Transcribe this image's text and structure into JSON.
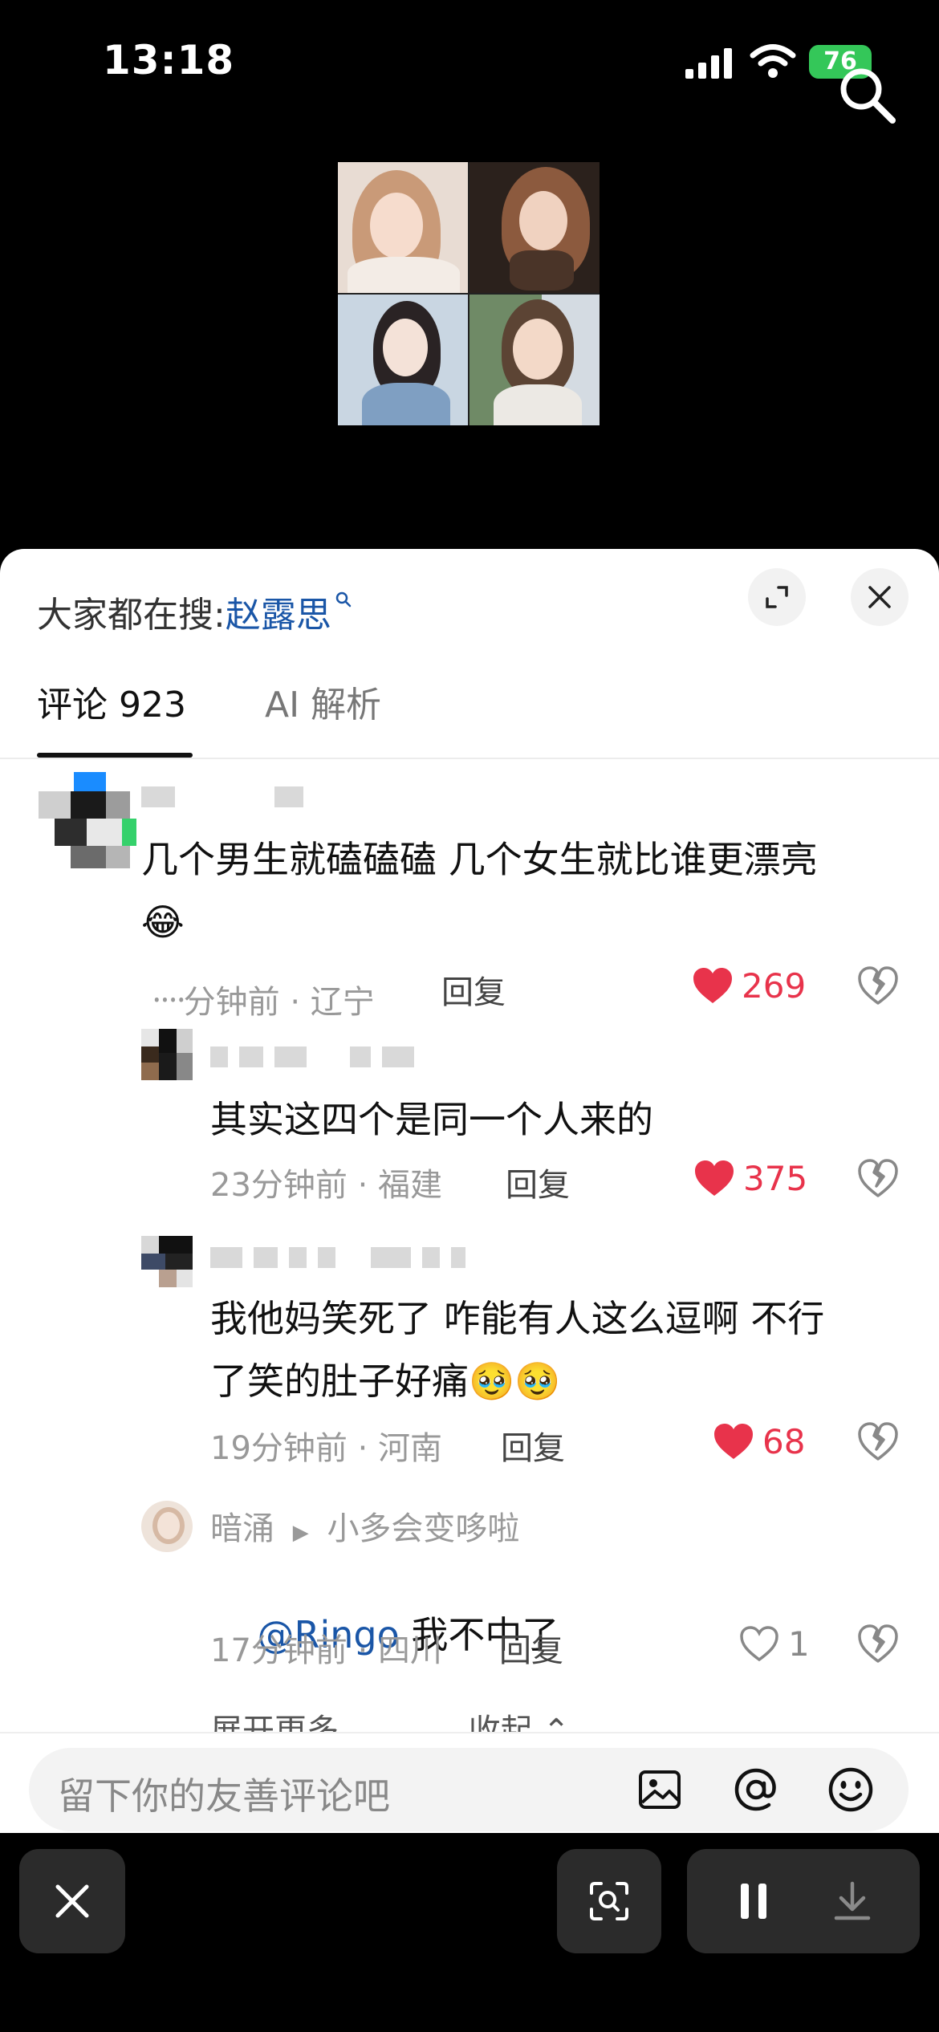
{
  "status_bar": {
    "time": "13:18",
    "battery": "76"
  },
  "icons": {
    "search": "search-icon",
    "expand": "expand-icon",
    "close": "close-icon",
    "heart": "heart-icon",
    "dislike": "broken-heart-icon"
  },
  "colors": {
    "like_red": "#e8334b",
    "link_blue": "#1a56a7",
    "battery_green": "#34c759"
  },
  "sheet": {
    "search_prefix": "大家都在搜:",
    "search_keyword": "赵露思",
    "tabs": [
      {
        "label": "评论 923",
        "active": true
      },
      {
        "label": "AI 解析",
        "active": false
      }
    ]
  },
  "comments": [
    {
      "text": "几个男生就磕磕磕 几个女生就比谁更漂亮\n😂",
      "meta": "᠁分钟前 · 辽宁",
      "reply": "回复",
      "likes": "269",
      "liked": true
    },
    {
      "text": "其实这四个是同一个人来的",
      "meta": "23分钟前 · 福建",
      "reply": "回复",
      "likes": "375",
      "liked": true
    },
    {
      "text": "我他妈笑死了 咋能有人这么逗啊 不行\n了笑的肚子好痛🥹🥹",
      "meta": "19分钟前 · 河南",
      "reply": "回复",
      "likes": "68",
      "liked": true
    },
    {
      "user": "暗涌",
      "reply_to": "小多会变哆啦",
      "mention": "@Ringo",
      "text": " 我不中了",
      "meta": "17分钟前 · 四川",
      "reply": "回复",
      "likes": "1",
      "liked": false
    }
  ],
  "expand_more": "展开更多",
  "collapse": "收起",
  "input": {
    "placeholder": "留下你的友善评论吧"
  }
}
